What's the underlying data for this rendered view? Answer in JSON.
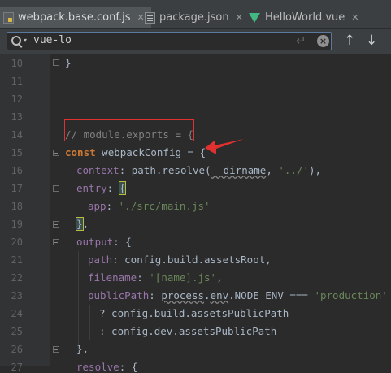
{
  "tabs": [
    {
      "label": "webpack.base.conf.js",
      "icon": "js-file-icon",
      "active": true
    },
    {
      "label": "package.json",
      "icon": "json-file-icon",
      "active": false
    },
    {
      "label": "HelloWorld.vue",
      "icon": "vue-file-icon",
      "active": false
    }
  ],
  "search": {
    "value": "vue-lo"
  },
  "lines": [
    {
      "num": "10",
      "text": "}"
    },
    {
      "num": "11",
      "text": ""
    },
    {
      "num": "12",
      "text": ""
    },
    {
      "num": "13",
      "text": ""
    },
    {
      "num": "14",
      "text": "// module.exports = {"
    },
    {
      "num": "15",
      "text": "const webpackConfig = {"
    },
    {
      "num": "16",
      "text": "context: path.resolve(__dirname, '../'),"
    },
    {
      "num": "17",
      "text": "entry: {"
    },
    {
      "num": "18",
      "text": "app: './src/main.js'"
    },
    {
      "num": "19",
      "text": "},"
    },
    {
      "num": "20",
      "text": "output: {"
    },
    {
      "num": "21",
      "text": "path: config.build.assetsRoot,"
    },
    {
      "num": "22",
      "text": "filename: '[name].js',"
    },
    {
      "num": "23",
      "text": "publicPath: process.env.NODE_ENV === 'production'"
    },
    {
      "num": "24",
      "text": "? config.build.assetsPublicPath"
    },
    {
      "num": "25",
      "text": ": config.dev.assetsPublicPath"
    },
    {
      "num": "26",
      "text": "},"
    },
    {
      "num": "27",
      "text": "resolve: {"
    }
  ],
  "colors": {
    "background": "#2b2b2b",
    "gutter": "#313335",
    "keyword": "#cc7832",
    "string": "#6a8759",
    "comment": "#808080",
    "property": "#9876aa",
    "annotation": "#e03030"
  }
}
